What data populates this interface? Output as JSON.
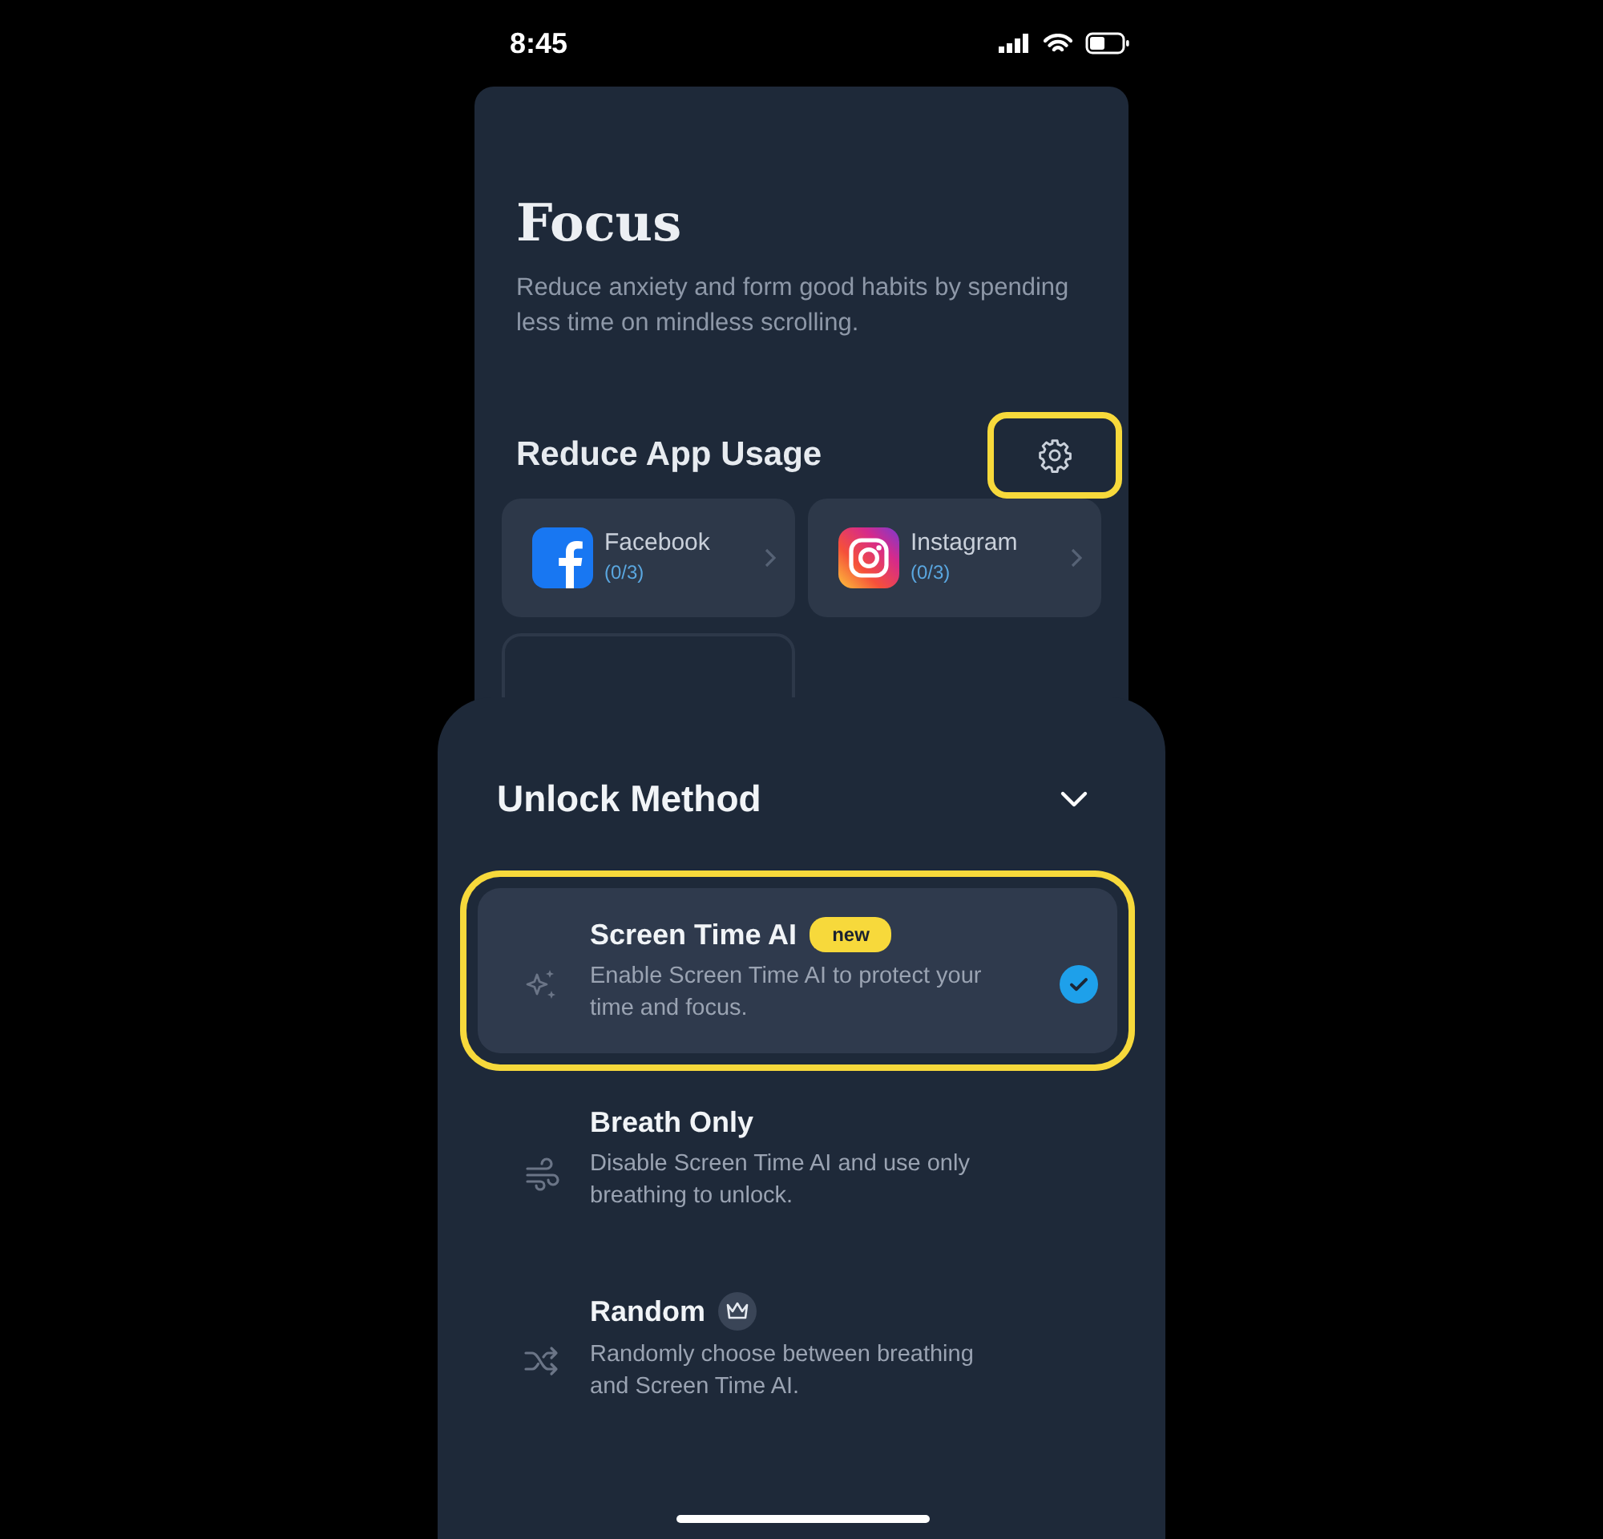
{
  "status_bar": {
    "time": "8:45"
  },
  "header": {
    "title": "Focus",
    "description": "Reduce anxiety and form good habits by spending less time on mindless scrolling."
  },
  "section": {
    "title": "Reduce App Usage",
    "settings_highlighted": true
  },
  "apps": [
    {
      "kind": "facebook",
      "name": "Facebook",
      "count": "(0/3)"
    },
    {
      "kind": "instagram",
      "name": "Instagram",
      "count": "(0/3)"
    }
  ],
  "sheet": {
    "title": "Unlock Method",
    "options": [
      {
        "kind": "sparkle",
        "title": "Screen Time AI",
        "badge": "new",
        "premium": false,
        "description": "Enable Screen Time AI to protect your time and focus.",
        "selected": true,
        "highlighted": true
      },
      {
        "kind": "wind",
        "title": "Breath Only",
        "premium": false,
        "description": "Disable Screen Time AI and use only breathing to unlock.",
        "selected": false,
        "highlighted": false
      },
      {
        "kind": "shuffle",
        "title": "Random",
        "premium": true,
        "description": "Randomly choose between breathing and Screen Time AI.",
        "selected": false,
        "highlighted": false
      }
    ]
  }
}
